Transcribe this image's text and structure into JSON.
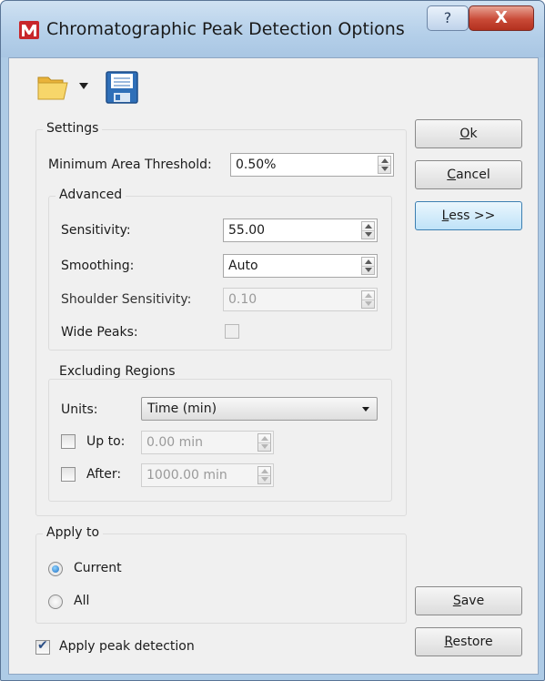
{
  "window": {
    "title": "Chromatographic Peak Detection Options",
    "help_label": "?",
    "close_label": "X"
  },
  "toolbar": {
    "open_icon": "folder-open-icon",
    "dropdown_icon": "chevron-down-icon",
    "save_icon": "floppy-disk-icon"
  },
  "settings": {
    "group_label": "Settings",
    "min_area_label": "Minimum Area Threshold:",
    "min_area_value": "0.50%",
    "advanced": {
      "group_label": "Advanced",
      "sensitivity_label": "Sensitivity:",
      "sensitivity_value": "55.00",
      "smoothing_label": "Smoothing:",
      "smoothing_value": "Auto",
      "shoulder_label": "Shoulder Sensitivity:",
      "shoulder_value": "0.10",
      "wide_peaks_label": "Wide Peaks:",
      "wide_peaks_checked": false
    },
    "excluding": {
      "group_label": "Excluding Regions",
      "units_label": "Units:",
      "units_value": "Time (min)",
      "up_to_label": "Up to:",
      "up_to_value": "0.00 min",
      "up_to_checked": false,
      "after_label": "After:",
      "after_value": "1000.00 min",
      "after_checked": false
    }
  },
  "apply_to": {
    "group_label": "Apply to",
    "current_label": "Current",
    "all_label": "All",
    "selected": "Current"
  },
  "apply_peak_detection": {
    "label": "Apply peak detection",
    "checked": true
  },
  "buttons": {
    "ok_mnemonic": "O",
    "ok_rest": "k",
    "cancel_mnemonic": "C",
    "cancel_rest": "ancel",
    "less_mnemonic": "L",
    "less_rest": "ess >>",
    "save_mnemonic": "S",
    "save_rest": "ave",
    "restore_mnemonic": "R",
    "restore_rest": "estore"
  },
  "colors": {
    "title_bar": "#b4cfe9",
    "dialog_bg": "#f0f0f0",
    "close_button": "#c94a37",
    "active_button": "#bfe2f8"
  }
}
